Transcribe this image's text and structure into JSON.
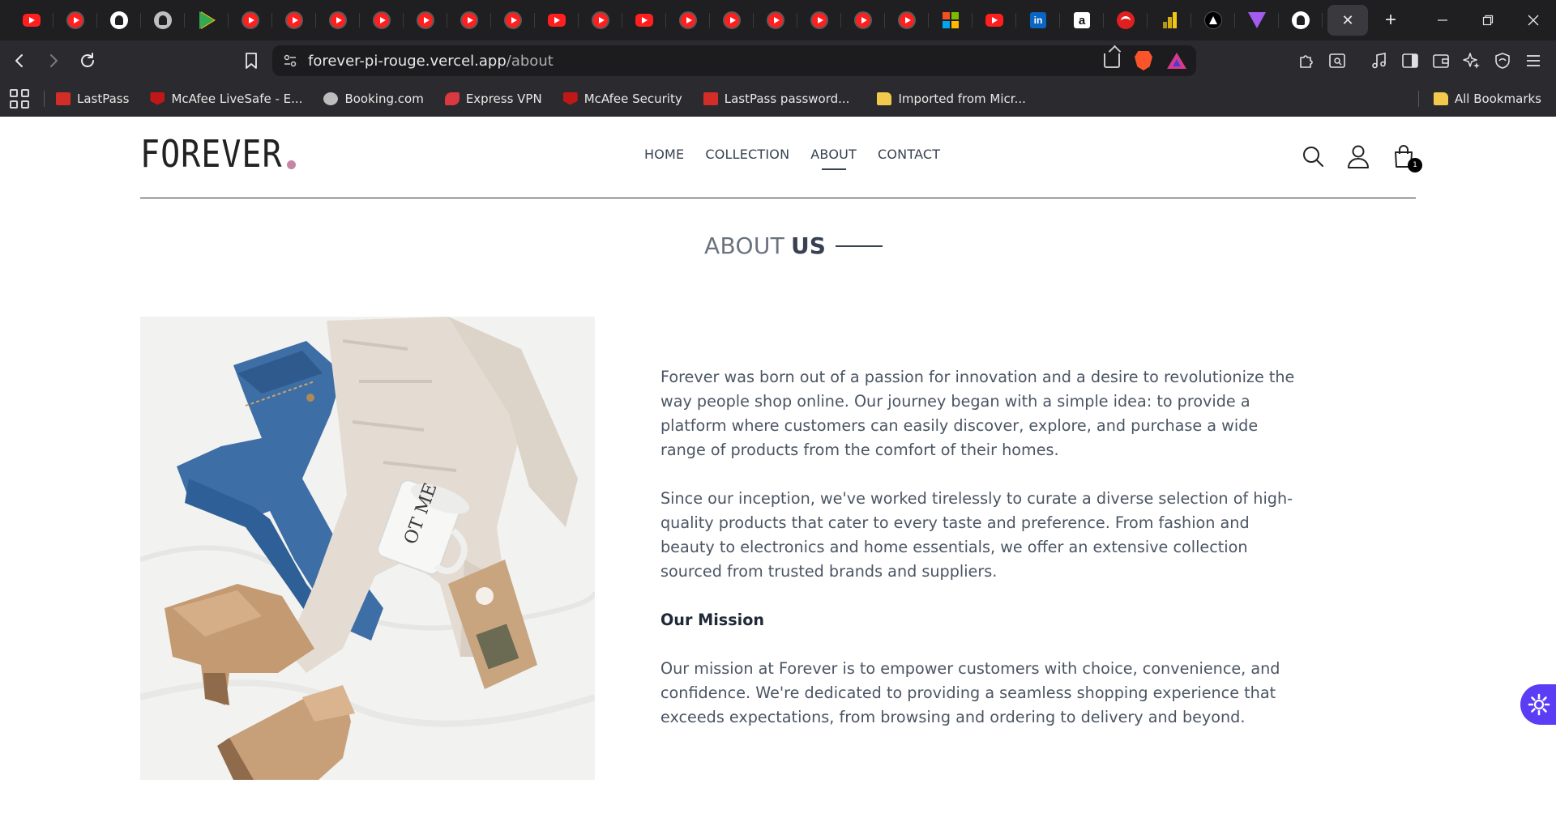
{
  "browser": {
    "tabs": [
      {
        "icon": "youtube-icon"
      },
      {
        "icon": "youtube-icon"
      },
      {
        "icon": "github-icon"
      },
      {
        "icon": "github-icon"
      },
      {
        "icon": "google-play-icon"
      },
      {
        "icon": "youtube-icon"
      },
      {
        "icon": "youtube-icon"
      },
      {
        "icon": "youtube-icon"
      },
      {
        "icon": "youtube-icon"
      },
      {
        "icon": "youtube-icon"
      },
      {
        "icon": "youtube-icon"
      },
      {
        "icon": "youtube-icon"
      },
      {
        "icon": "youtube-icon"
      },
      {
        "icon": "youtube-icon"
      },
      {
        "icon": "youtube-icon"
      },
      {
        "icon": "youtube-icon"
      },
      {
        "icon": "youtube-icon"
      },
      {
        "icon": "youtube-icon"
      },
      {
        "icon": "youtube-icon"
      },
      {
        "icon": "youtube-icon"
      },
      {
        "icon": "youtube-icon"
      },
      {
        "icon": "microsoft-icon"
      },
      {
        "icon": "youtube-icon"
      },
      {
        "icon": "linkedin-icon"
      },
      {
        "icon": "amazon-icon"
      },
      {
        "icon": "red-app-icon"
      },
      {
        "icon": "power-bi-icon"
      },
      {
        "icon": "triangle-app-icon"
      },
      {
        "icon": "vite-icon"
      },
      {
        "icon": "github-icon"
      }
    ],
    "active_tab_close": "✕",
    "new_tab": "+",
    "url": {
      "host": "forever-pi-rouge.vercel.app",
      "path": "/about"
    },
    "bookmarks": [
      {
        "label": "LastPass",
        "icon": "lastpass-icon"
      },
      {
        "label": "McAfee LiveSafe - E...",
        "icon": "mcafee-icon"
      },
      {
        "label": "Booking.com",
        "icon": "globe-icon"
      },
      {
        "label": "Express VPN",
        "icon": "expressvpn-icon"
      },
      {
        "label": "McAfee Security",
        "icon": "mcafee-icon"
      },
      {
        "label": "LastPass password...",
        "icon": "lastpass-icon"
      },
      {
        "label": "Imported from Micr...",
        "icon": "folder-icon"
      }
    ],
    "all_bookmarks": "All Bookmarks"
  },
  "site": {
    "logo": "FOREVER",
    "logo_dot_color": "#c586a5",
    "nav": [
      {
        "label": "HOME",
        "active": false
      },
      {
        "label": "COLLECTION",
        "active": false
      },
      {
        "label": "ABOUT",
        "active": true
      },
      {
        "label": "CONTACT",
        "active": false
      }
    ],
    "cart_count": "1"
  },
  "about": {
    "title_light": "ABOUT",
    "title_bold": "US",
    "paragraph1": "Forever was born out of a passion for innovation and a desire to revolutionize the way people shop online. Our journey began with a simple idea: to provide a platform where customers can easily discover, explore, and purchase a wide range of products from the comfort of their homes.",
    "paragraph2": "Since our inception, we've worked tirelessly to curate a diverse selection of high-quality products that cater to every taste and preference. From fashion and beauty to electronics and home essentials, we offer an extensive collection sourced from trusted brands and suppliers.",
    "mission_heading": "Our Mission",
    "mission_text": "Our mission at Forever is to empower customers with choice, convenience, and confidence. We're dedicated to providing a seamless shopping experience that exceeds expectations, from browsing and ordering to delivery and beyond.",
    "mug_text": "OT ME"
  }
}
